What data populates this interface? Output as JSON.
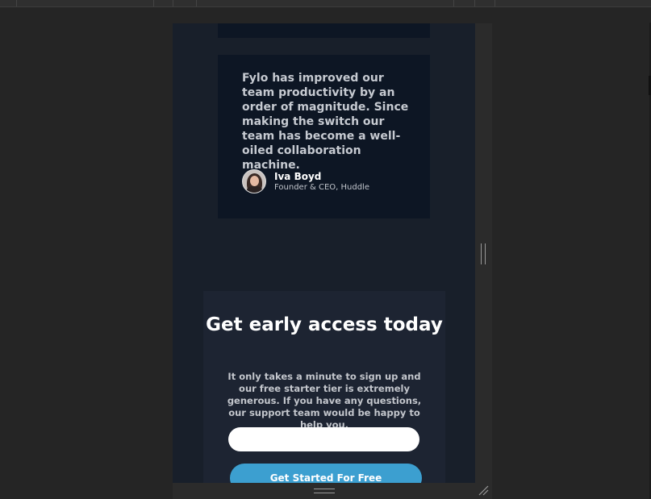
{
  "testimonial": {
    "quote": "Fylo has improved our team productivity by an order of magnitude. Since making the switch our team has become a well-oiled collaboration machine.",
    "author_name": "Iva Boyd",
    "author_title": "Founder & CEO, Huddle"
  },
  "cta": {
    "title": "Get early access today",
    "text": "It only takes a minute to sign up and our free starter tier is extremely generous. If you have any questions, our support team would be happy to help you.",
    "email_value": "",
    "button_label": "Get Started For Free"
  },
  "colors": {
    "page_background": "#181f2a",
    "card_background": "#0d1624",
    "cta_background": "#1d2432",
    "button": "#3c9fd0"
  }
}
